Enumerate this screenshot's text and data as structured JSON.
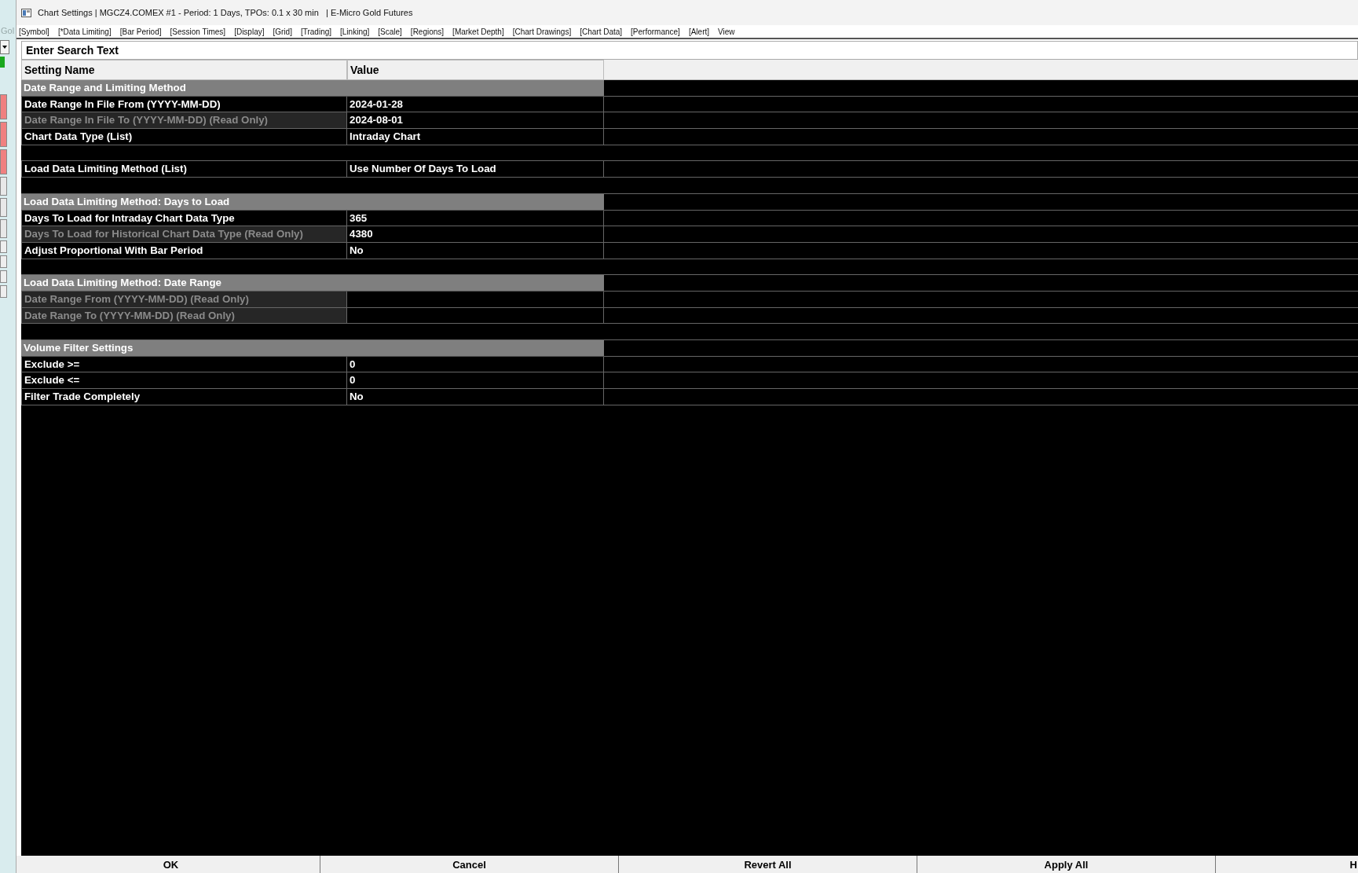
{
  "background_window": {
    "label": "Gol"
  },
  "window": {
    "title": "Chart Settings | MGCZ4.COMEX #1 - Period: 1 Days, TPOs: 0.1 x 30 min   | E-Micro Gold Futures"
  },
  "tabs": [
    {
      "label": "[Symbol]"
    },
    {
      "label": "[*Data Limiting]"
    },
    {
      "label": "[Bar Period]"
    },
    {
      "label": "[Session Times]"
    },
    {
      "label": "[Display]"
    },
    {
      "label": "[Grid]"
    },
    {
      "label": "[Trading]"
    },
    {
      "label": "[Linking]"
    },
    {
      "label": "[Scale]"
    },
    {
      "label": "[Regions]"
    },
    {
      "label": "[Market Depth]"
    },
    {
      "label": "[Chart Drawings]"
    },
    {
      "label": "[Chart Data]"
    },
    {
      "label": "[Performance]"
    },
    {
      "label": "[Alert]"
    },
    {
      "label": "View"
    }
  ],
  "search": {
    "placeholder": "Enter Search Text"
  },
  "table": {
    "columns": [
      "Setting Name",
      "Value"
    ],
    "rows": [
      {
        "kind": "section",
        "name": "Date Range and Limiting Method"
      },
      {
        "kind": "setting",
        "name": "Date Range In File From (YYYY-MM-DD)",
        "value": "2024-01-28",
        "read_only": false
      },
      {
        "kind": "setting",
        "name": "Date Range In File To (YYYY-MM-DD) (Read Only)",
        "value": "2024-08-01",
        "read_only": true
      },
      {
        "kind": "setting",
        "name": "Chart Data Type (List)",
        "value": "Intraday Chart",
        "read_only": false
      },
      {
        "kind": "blank"
      },
      {
        "kind": "setting",
        "name": "Load Data Limiting Method (List)",
        "value": "Use Number Of Days To Load",
        "read_only": false
      },
      {
        "kind": "blank"
      },
      {
        "kind": "section",
        "name": "Load Data Limiting Method: Days to Load"
      },
      {
        "kind": "setting",
        "name": "Days To Load for Intraday Chart Data Type",
        "value": "365",
        "read_only": false
      },
      {
        "kind": "setting",
        "name": "Days To Load for Historical Chart Data Type (Read Only)",
        "value": "4380",
        "read_only": true
      },
      {
        "kind": "setting",
        "name": "Adjust Proportional With Bar Period",
        "value": "No",
        "read_only": false
      },
      {
        "kind": "blank"
      },
      {
        "kind": "section",
        "name": "Load Data Limiting Method: Date Range"
      },
      {
        "kind": "setting",
        "name": "Date Range From (YYYY-MM-DD) (Read Only)",
        "read_only": true
      },
      {
        "kind": "setting",
        "name": "Date Range To (YYYY-MM-DD) (Read Only)",
        "read_only": true
      },
      {
        "kind": "blank"
      },
      {
        "kind": "section",
        "name": "Volume Filter Settings"
      },
      {
        "kind": "setting",
        "name": "Exclude >=",
        "value": "0",
        "read_only": false
      },
      {
        "kind": "setting",
        "name": "Exclude <=",
        "value": "0",
        "read_only": false
      },
      {
        "kind": "setting",
        "name": "Filter Trade Completely",
        "value": "No",
        "read_only": false
      }
    ]
  },
  "buttons": [
    "OK",
    "Cancel",
    "Revert All",
    "Apply All",
    "H"
  ]
}
